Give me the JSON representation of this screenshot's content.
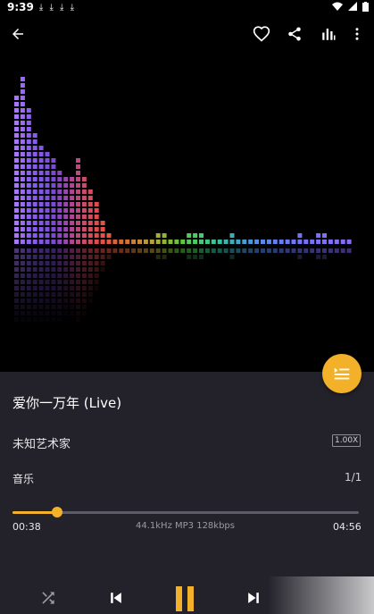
{
  "status": {
    "time": "9:39",
    "download_icons": "⤓ ⤓ ⤓ ⤓"
  },
  "topbar": {
    "back_icon": "arrow-left",
    "actions": [
      "heart",
      "share",
      "equalizer",
      "more-vert"
    ]
  },
  "song": {
    "title": "爱你一万年 (Live)",
    "artist": "未知艺术家",
    "speed": "1.00X",
    "album": "音乐",
    "index": "1/1"
  },
  "progress": {
    "current": "00:38",
    "total": "04:56",
    "info": "44.1kHz MP3 128kbps",
    "fraction": 0.128
  },
  "visualizer": {
    "levels": [
      24,
      27,
      22,
      18,
      16,
      15,
      14,
      12,
      11,
      11,
      14,
      11,
      9,
      7,
      4,
      2,
      1,
      1,
      1,
      1,
      1,
      1,
      1,
      2,
      2,
      1,
      1,
      1,
      2,
      2,
      2,
      1,
      1,
      1,
      1,
      2,
      1,
      1,
      1,
      1,
      1,
      1,
      1,
      1,
      1,
      1,
      2,
      1,
      1,
      2,
      2,
      1,
      1,
      1,
      1
    ],
    "colors": [
      "#a677f6",
      "#9a6cf4",
      "#8d62f1",
      "#8a5bee",
      "#8456e6",
      "#7f4fdd",
      "#7b4ad0",
      "#8a48c0",
      "#9b46b0",
      "#b14695",
      "#c0467f",
      "#cc4a6c",
      "#d84b5d",
      "#e14b50",
      "#e85045",
      "#e55a3b",
      "#d9613b",
      "#d46b3a",
      "#cf743a",
      "#c97f3a",
      "#c48a3a",
      "#bf9639",
      "#b7a238",
      "#a7ad37",
      "#93b536",
      "#7fbd38",
      "#6dc33e",
      "#5fc748",
      "#54cb54",
      "#4bcc62",
      "#43cb72",
      "#3ec884",
      "#3ac393",
      "#39bd9f",
      "#3bb5ad",
      "#3eadba",
      "#42a5c5",
      "#479dcf",
      "#4c96d8",
      "#5190e0",
      "#568ae6",
      "#5b86ec",
      "#607ff1",
      "#657cf4",
      "#6a79f6",
      "#6f76f7",
      "#7274f8",
      "#7572f8",
      "#7871f8",
      "#7b70f8",
      "#7e6ff8",
      "#816ef8",
      "#846df8",
      "#876cf8",
      "#8a6bf8"
    ]
  },
  "accent": "#f3b12a"
}
